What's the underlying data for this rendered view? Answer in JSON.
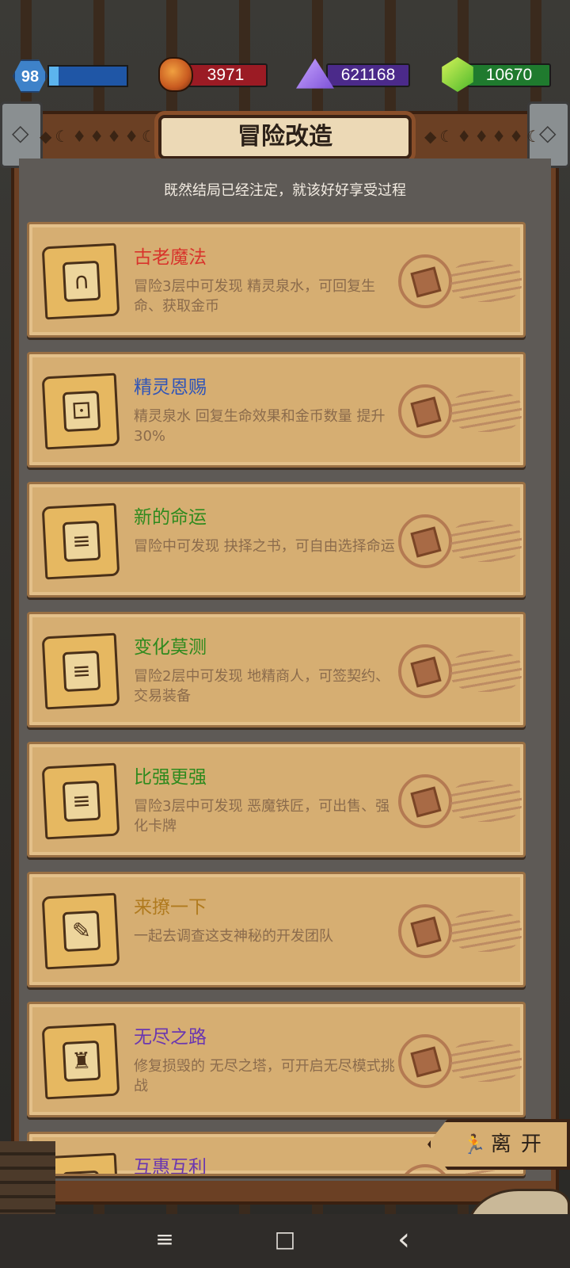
{
  "resources": {
    "level": "98",
    "xp_progress": 0.12,
    "ore": "3971",
    "crystal": "621168",
    "gem": "10670",
    "colors": {
      "ore_bar": "#9b1b24",
      "crystal_bar": "#4b2a8a",
      "gem_bar": "#1f7a2e",
      "xp_bar": "#1f56a6"
    },
    "icons": [
      "level-hex-icon",
      "ore-icon",
      "crystal-pyramid-icon",
      "gem-icon"
    ]
  },
  "header": {
    "title": "冒险改造",
    "subtitle": "既然结局已经注定，就该好好享受过程"
  },
  "cards": [
    {
      "title": "古老魔法",
      "title_color": "#d8342c",
      "desc": "冒险3层中可发现 精灵泉水，可回复生命、获取金币",
      "icon": "archway-icon",
      "glyph": "∩"
    },
    {
      "title": "精灵恩赐",
      "title_color": "#2f54b8",
      "desc": "精灵泉水 回复生命效果和金币数量 提升 30%",
      "icon": "dice-icon",
      "glyph": "⚀"
    },
    {
      "title": "新的命运",
      "title_color": "#2f8a1e",
      "desc": "冒险中可发现 抉择之书，可自由选择命运",
      "icon": "page-icon",
      "glyph": "≡"
    },
    {
      "title": "变化莫测",
      "title_color": "#2f8a1e",
      "desc": "冒险2层中可发现 地精商人，可签契约、交易装备",
      "icon": "page-icon",
      "glyph": "≡"
    },
    {
      "title": "比强更强",
      "title_color": "#2f8a1e",
      "desc": "冒险3层中可发现 恶魔铁匠，可出售、强化卡牌",
      "icon": "page-icon",
      "glyph": "≡"
    },
    {
      "title": "来撩一下",
      "title_color": "#b07a1e",
      "desc": "一起去调查这支神秘的开发团队",
      "icon": "wrench-icon",
      "glyph": "✎"
    },
    {
      "title": "无尽之路",
      "title_color": "#6a36b0",
      "desc": "修复损毁的 无尽之塔，可开启无尽模式挑战",
      "icon": "top-hat-icon",
      "glyph": "♜"
    },
    {
      "title": "互惠互利",
      "title_color": "#6a36b0",
      "desc": "",
      "icon": "page-icon",
      "glyph": "≡"
    }
  ],
  "leave_button": {
    "label": "离开",
    "icon": "running-man-icon"
  },
  "nav": {
    "menu_icon": "≡",
    "home_icon": "□",
    "back_icon": "‹"
  }
}
